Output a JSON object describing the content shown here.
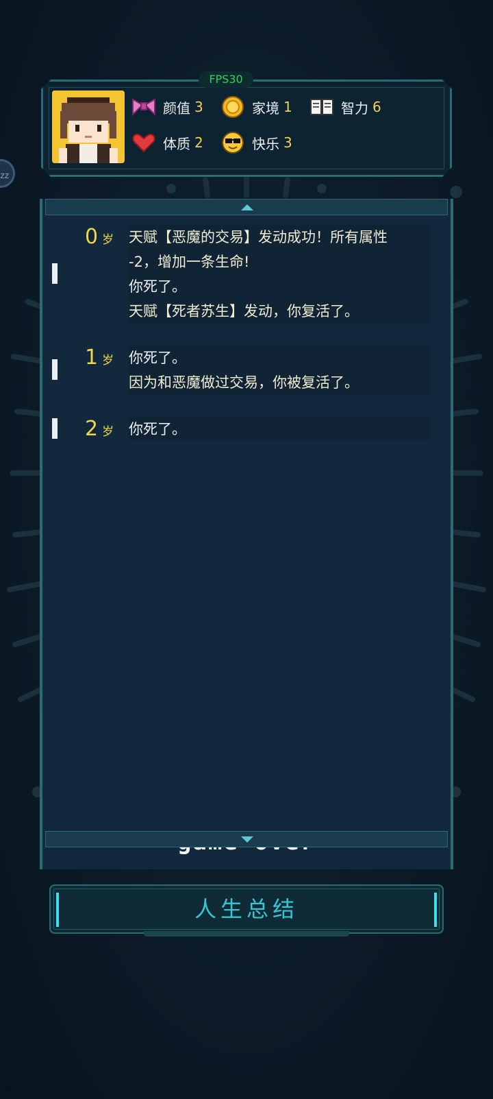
{
  "fps": "FPS30",
  "side_bubble": "zz",
  "stats": [
    {
      "icon": "bow-icon",
      "label": "颜值",
      "value": "3"
    },
    {
      "icon": "coin-icon",
      "label": "家境",
      "value": "1"
    },
    {
      "icon": "book-icon",
      "label": "智力",
      "value": "6"
    },
    {
      "icon": "heart-icon",
      "label": "体质",
      "value": "2"
    },
    {
      "icon": "sunglasses-face-icon",
      "label": "快乐",
      "value": "3"
    }
  ],
  "log": [
    {
      "age": "0",
      "unit": "岁",
      "lines": [
        "天赋【恶魔的交易】发动成功！所有属性",
        "-2，增加一条生命!",
        "你死了。",
        "天赋【死者苏生】发动，你复活了。"
      ]
    },
    {
      "age": "1",
      "unit": "岁",
      "lines": [
        "你死了。",
        "因为和恶魔做过交易，你被复活了。"
      ]
    },
    {
      "age": "2",
      "unit": "岁",
      "lines": [
        "你死了。"
      ]
    }
  ],
  "game_over": "— game over —",
  "summary_button": "人生总结",
  "colors": {
    "accent": "#2e6b70",
    "age_yellow": "#f1d84a",
    "stat_value": "#f2cf58",
    "button_text": "#39c4d6",
    "fps_green": "#2fd15a"
  }
}
